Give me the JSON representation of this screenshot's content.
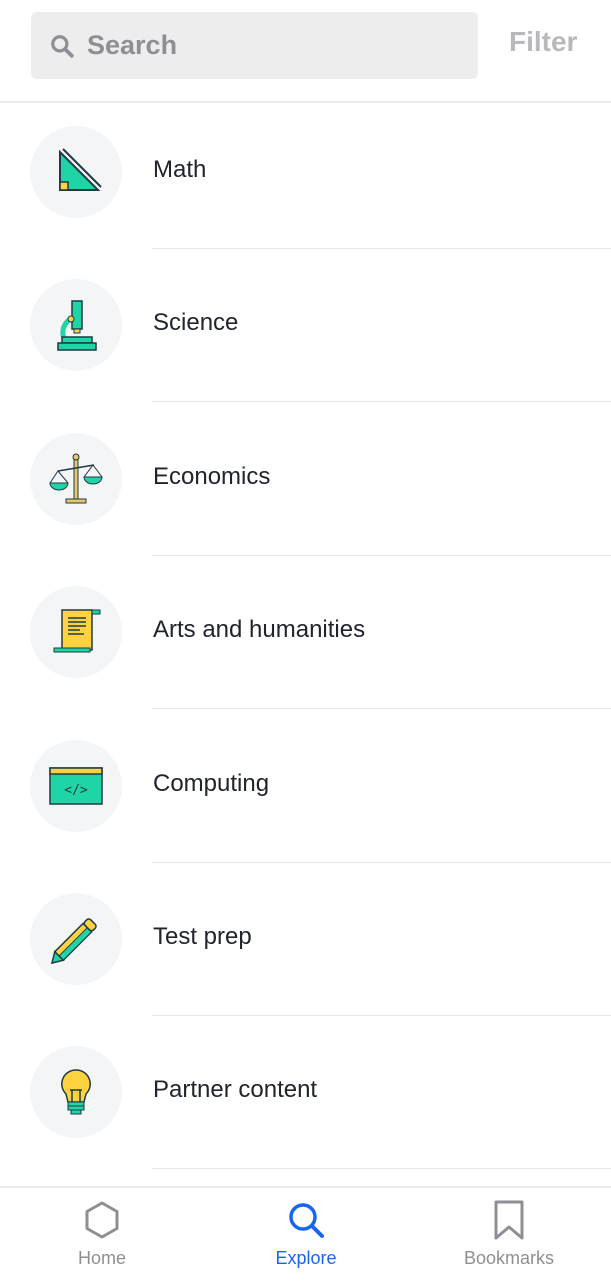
{
  "search": {
    "placeholder": "Search",
    "icon": "search-icon"
  },
  "filter_label": "Filter",
  "subjects": [
    {
      "label": "Math",
      "icon": "triangle-ruler-icon"
    },
    {
      "label": "Science",
      "icon": "microscope-icon"
    },
    {
      "label": "Economics",
      "icon": "scales-icon"
    },
    {
      "label": "Arts and humanities",
      "icon": "scroll-icon"
    },
    {
      "label": "Computing",
      "icon": "code-window-icon"
    },
    {
      "label": "Test prep",
      "icon": "pencil-icon"
    },
    {
      "label": "Partner content",
      "icon": "lightbulb-icon"
    }
  ],
  "nav": [
    {
      "label": "Home",
      "icon": "hexagon-icon"
    },
    {
      "label": "Explore",
      "icon": "search-icon",
      "active": true
    },
    {
      "label": "Bookmarks",
      "icon": "bookmark-icon"
    }
  ],
  "colors": {
    "accent": "#1865f2",
    "teal": "#1fd5a6",
    "yellow": "#ffd23f"
  }
}
